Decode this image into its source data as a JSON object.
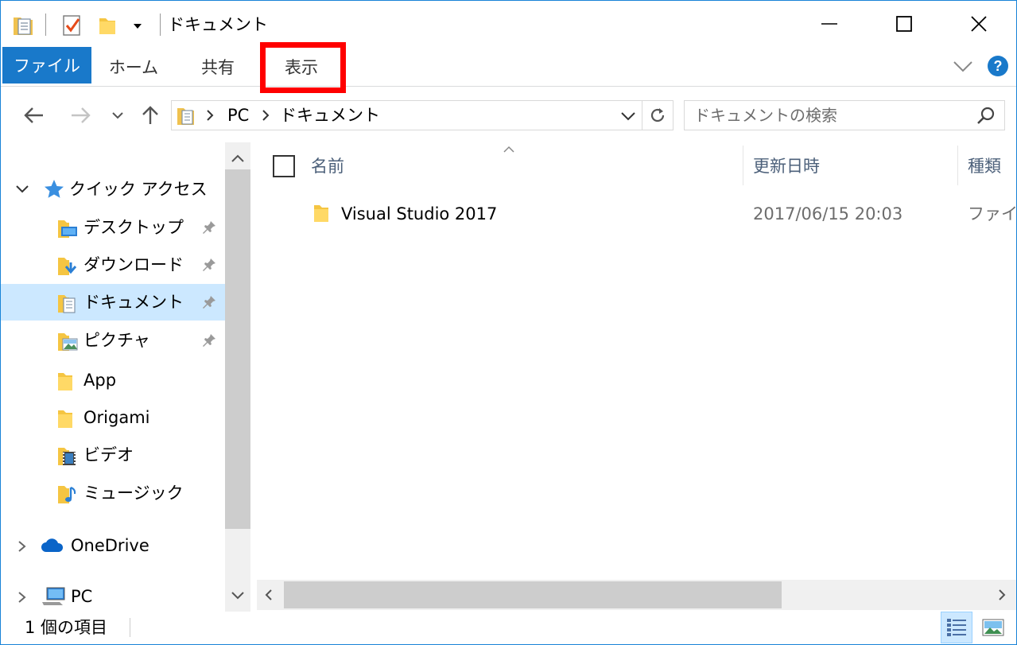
{
  "window": {
    "title": "ドキュメント",
    "accent": "#1979ca",
    "minimize_icon": "minimize-icon",
    "maximize_icon": "maximize-icon",
    "close_icon": "close-icon"
  },
  "ribbon": {
    "tabs": [
      {
        "label": "ファイル"
      },
      {
        "label": "ホーム"
      },
      {
        "label": "共有"
      },
      {
        "label": "表示"
      }
    ],
    "highlighted_tab": "表示",
    "highlight_color": "#ff0000"
  },
  "address": {
    "breadcrumb": [
      "PC",
      "ドキュメント"
    ],
    "search_placeholder": "ドキュメントの検索"
  },
  "nav": {
    "quick_access": {
      "label": "クイック アクセス",
      "items": [
        {
          "label": "デスクトップ",
          "pinned": true
        },
        {
          "label": "ダウンロード",
          "pinned": true
        },
        {
          "label": "ドキュメント",
          "pinned": true,
          "selected": true
        },
        {
          "label": "ピクチャ",
          "pinned": true
        },
        {
          "label": "App",
          "pinned": false
        },
        {
          "label": "Origami",
          "pinned": false
        },
        {
          "label": "ビデオ",
          "pinned": false
        },
        {
          "label": "ミュージック",
          "pinned": false
        }
      ]
    },
    "onedrive": {
      "label": "OneDrive"
    },
    "pc": {
      "label": "PC"
    }
  },
  "content": {
    "columns": [
      {
        "label": "名前"
      },
      {
        "label": "更新日時"
      },
      {
        "label": "種類"
      }
    ],
    "rows": [
      {
        "name": "Visual Studio 2017",
        "modified": "2017/06/15 20:03",
        "type": "ファイル"
      }
    ]
  },
  "status": {
    "item_count": "1 個の項目"
  }
}
